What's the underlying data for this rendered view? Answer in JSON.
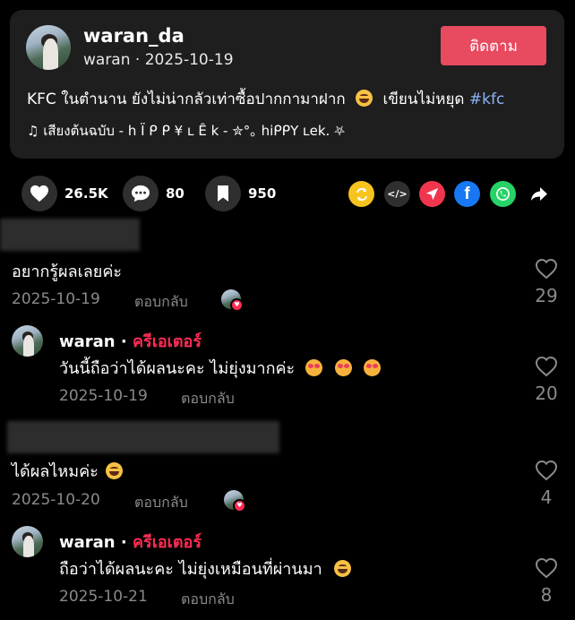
{
  "post": {
    "username": "waran_da",
    "handle": "waran · 2025-10-19",
    "follow_label": "ติดตาม",
    "caption": "KFC ในตำนาน ยังไม่น่ากลัวเท่าซื้อปากกามาฝาก",
    "caption_tail": "เขียนไม่หยุด",
    "hashtag": "#kfc",
    "music": "♫  เสียงต้นฉบับ - h Ï ᑭ ᑭ ¥ ʟ Ȇ k - ✮°｡ hiᑭᑭY ʟek. ⛧"
  },
  "actions": {
    "likes": "26.5K",
    "comments": "80",
    "saves": "950"
  },
  "colors": {
    "accent": "#fe2c55",
    "follow_bg": "#e84a5f",
    "hashtag": "#8ab4f8"
  },
  "share_icons": [
    "repost-icon",
    "embed-icon",
    "send-icon",
    "facebook-icon",
    "whatsapp-icon",
    "share-arrow-icon"
  ],
  "comments": [
    {
      "text": "อยากรู้ผลเลยค่ะ",
      "date": "2025-10-19",
      "reply_label": "ตอบกลับ",
      "likes": "29",
      "creator_reply": {
        "name": "waran",
        "sep": " · ",
        "badge": "ครีเอเตอร์",
        "text": "วันนี้ถือว่าได้ผลนะคะ ไม่ยุ่งมากค่ะ",
        "date": "2025-10-19",
        "reply_label": "ตอบกลับ",
        "likes": "20"
      }
    },
    {
      "text": "ได้ผลไหมค่ะ",
      "date": "2025-10-20",
      "reply_label": "ตอบกลับ",
      "likes": "4",
      "creator_reply": {
        "name": "waran",
        "sep": " · ",
        "badge": "ครีเอเตอร์",
        "text": "ถือว่าได้ผลนะคะ ไม่ยุ่งเหมือนที่ผ่านมา",
        "date": "2025-10-21",
        "reply_label": "ตอบกลับ",
        "likes": "8"
      }
    }
  ]
}
